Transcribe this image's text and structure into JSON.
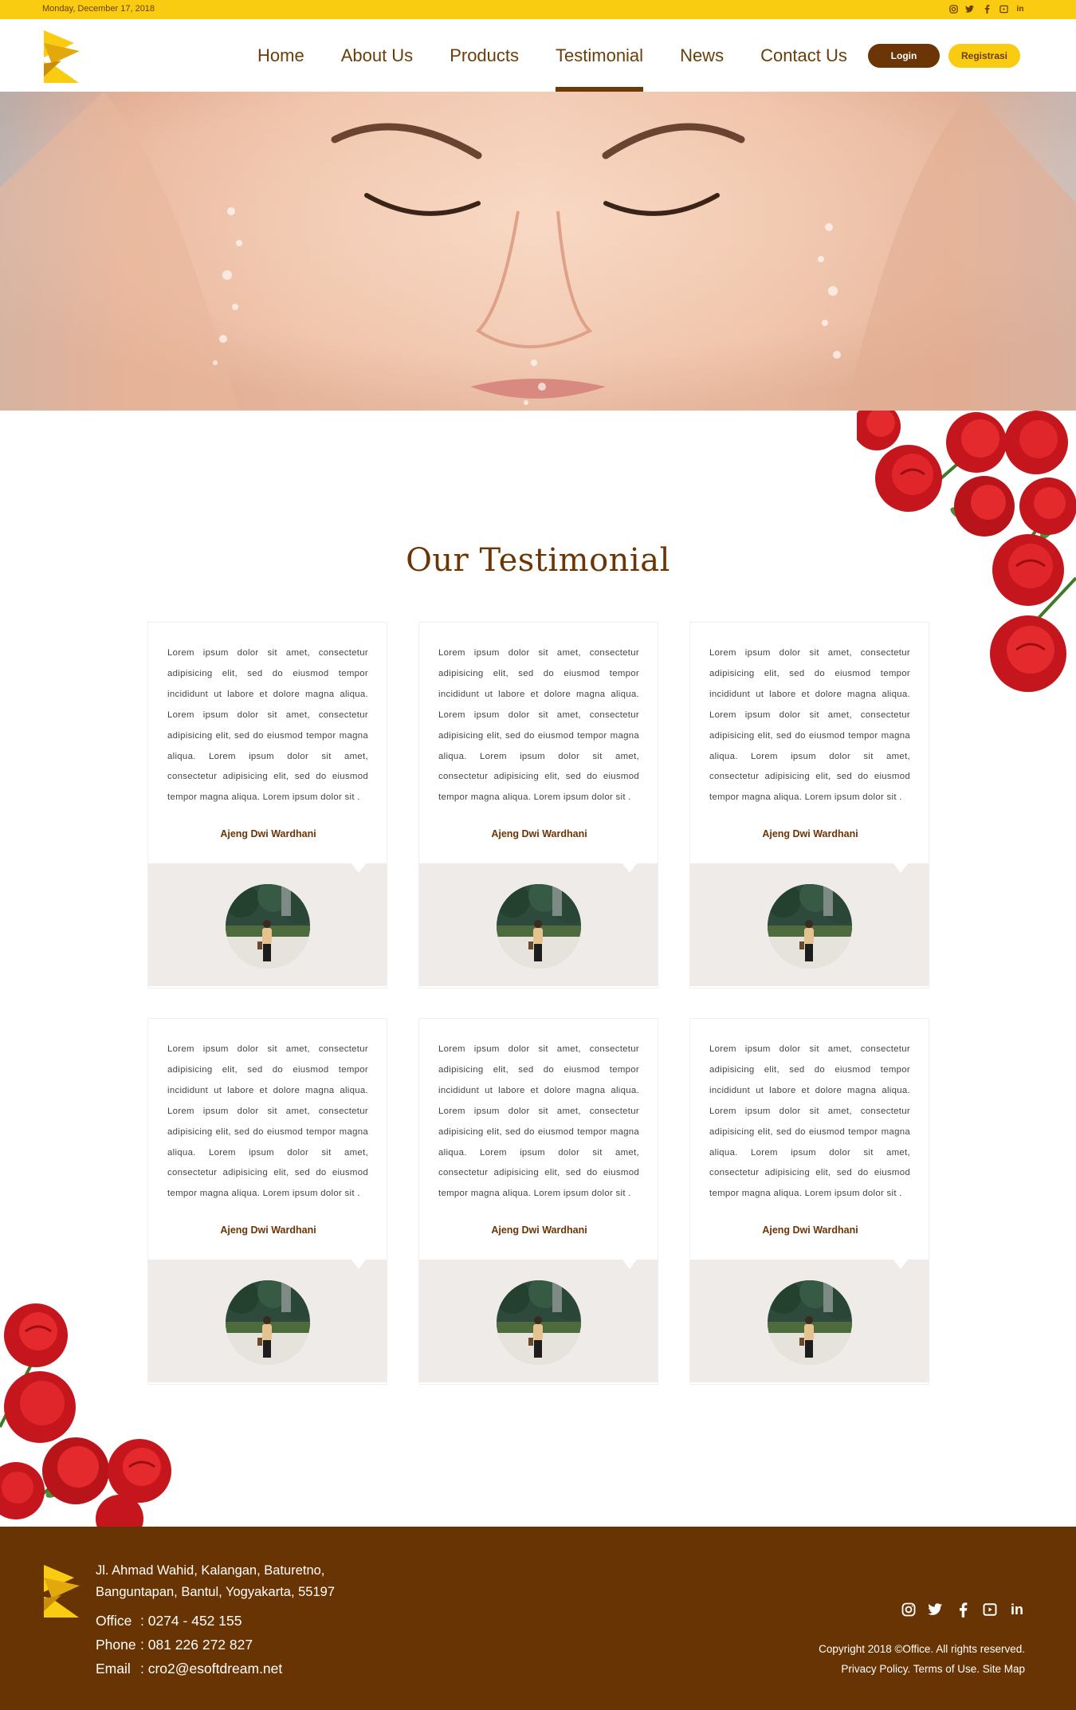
{
  "topbar": {
    "date": "Monday, December 17, 2018",
    "socials": [
      "instagram-icon",
      "twitter-icon",
      "facebook-icon",
      "youtube-icon",
      "linkedin-icon"
    ]
  },
  "nav": {
    "items": [
      {
        "label": "Home"
      },
      {
        "label": "About Us"
      },
      {
        "label": "Products"
      },
      {
        "label": "Testimonial"
      },
      {
        "label": "News"
      },
      {
        "label": "Contact Us"
      }
    ],
    "active": "Testimonial",
    "login_label": "Login",
    "register_label": "Registrasi"
  },
  "testimonial": {
    "title": "Our Testimonial",
    "cards": [
      {
        "text": "Lorem ipsum dolor sit amet, consectetur adipisicing elit, sed do eiusmod tempor incididunt ut labore et dolore magna aliqua. Lorem ipsum dolor sit amet, consectetur adipisicing elit, sed do eiusmod tempor magna aliqua. Lorem ipsum dolor sit amet, consectetur adipisicing elit, sed do eiusmod tempor magna aliqua. Lorem ipsum dolor sit .",
        "name": "Ajeng Dwi Wardhani"
      },
      {
        "text": "Lorem ipsum dolor sit amet, consectetur adipisicing elit, sed do eiusmod tempor incididunt ut labore et dolore magna aliqua. Lorem ipsum dolor sit amet, consectetur adipisicing elit, sed do eiusmod tempor magna aliqua. Lorem ipsum dolor sit amet, consectetur adipisicing elit, sed do eiusmod tempor magna aliqua. Lorem ipsum dolor sit .",
        "name": "Ajeng Dwi Wardhani"
      },
      {
        "text": "Lorem ipsum dolor sit amet, consectetur adipisicing elit, sed do eiusmod tempor incididunt ut labore et dolore magna aliqua. Lorem ipsum dolor sit amet, consectetur adipisicing elit, sed do eiusmod tempor magna aliqua. Lorem ipsum dolor sit amet, consectetur adipisicing elit, sed do eiusmod tempor magna aliqua. Lorem ipsum dolor sit .",
        "name": "Ajeng Dwi Wardhani"
      },
      {
        "text": "Lorem ipsum dolor sit amet, consectetur adipisicing elit, sed do eiusmod tempor incididunt ut labore et dolore magna aliqua. Lorem ipsum dolor sit amet, consectetur adipisicing elit, sed do eiusmod tempor magna aliqua. Lorem ipsum dolor sit amet, consectetur adipisicing elit, sed do eiusmod tempor magna aliqua. Lorem ipsum dolor sit .",
        "name": "Ajeng Dwi Wardhani"
      },
      {
        "text": "Lorem ipsum dolor sit amet, consectetur adipisicing elit, sed do eiusmod tempor incididunt ut labore et dolore magna aliqua. Lorem ipsum dolor sit amet, consectetur adipisicing elit, sed do eiusmod tempor magna aliqua. Lorem ipsum dolor sit amet, consectetur adipisicing elit, sed do eiusmod tempor magna aliqua. Lorem ipsum dolor sit .",
        "name": "Ajeng Dwi Wardhani"
      },
      {
        "text": "Lorem ipsum dolor sit amet, consectetur adipisicing elit, sed do eiusmod tempor incididunt ut labore et dolore magna aliqua. Lorem ipsum dolor sit amet, consectetur adipisicing elit, sed do eiusmod tempor magna aliqua. Lorem ipsum dolor sit amet, consectetur adipisicing elit, sed do eiusmod tempor magna aliqua. Lorem ipsum dolor sit .",
        "name": "Ajeng Dwi Wardhani"
      }
    ]
  },
  "footer": {
    "address_line1": "Jl. Ahmad Wahid, Kalangan, Baturetno,",
    "address_line2": "Banguntapan, Bantul, Yogyakarta, 55197",
    "office_label": "Office",
    "office_value": ": 0274 - 452 155",
    "phone_label": "Phone",
    "phone_value": ": 081 226 272 827",
    "email_label": "Email",
    "email_value": ": cro2@esoftdream.net",
    "copyright": "Copyright 2018 ©Office. All rights reserved.",
    "links": "Privacy Policy. Terms of Use. Site Map",
    "socials": [
      "instagram-icon",
      "twitter-icon",
      "facebook-icon",
      "youtube-icon",
      "linkedin-icon"
    ]
  },
  "colors": {
    "brand_yellow": "#f9cc11",
    "brand_brown": "#683403",
    "card_footer": "#efebe8"
  }
}
